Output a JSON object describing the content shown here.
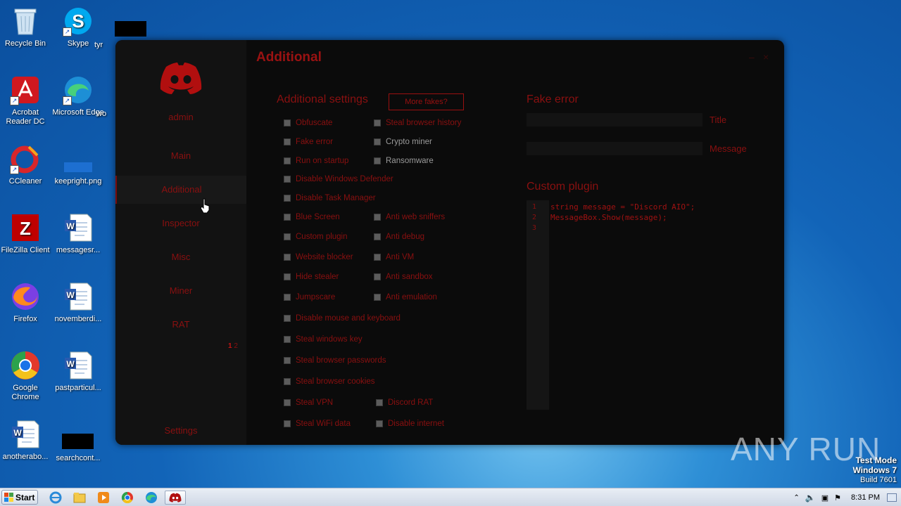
{
  "desktop": {
    "icons": [
      {
        "label": "Recycle Bin",
        "icon": "recycle-bin-icon"
      },
      {
        "label": "Skype",
        "icon": "skype-icon"
      },
      {
        "label": "tyr",
        "icon": "redacted"
      },
      {
        "label": "Acrobat Reader DC",
        "icon": "acrobat-icon"
      },
      {
        "label": "Microsoft Edge",
        "icon": "edge-icon"
      },
      {
        "label": "wo",
        "icon": "word-icon"
      },
      {
        "label": "CCleaner",
        "icon": "ccleaner-icon"
      },
      {
        "label": "keepright.png",
        "icon": "image-file-icon"
      },
      {
        "label": "FileZilla Client",
        "icon": "filezilla-icon"
      },
      {
        "label": "messagesr...",
        "icon": "word-doc-icon"
      },
      {
        "label": "Firefox",
        "icon": "firefox-icon"
      },
      {
        "label": "novemberdi...",
        "icon": "word-doc-icon"
      },
      {
        "label": "Google Chrome",
        "icon": "chrome-icon"
      },
      {
        "label": "pastparticul...",
        "icon": "word-doc-icon"
      },
      {
        "label": "anotherabo...",
        "icon": "word-doc-icon"
      },
      {
        "label": "searchcont...",
        "icon": "redacted"
      }
    ]
  },
  "app": {
    "title": "Additional",
    "controls": {
      "minimize": "–",
      "close": "×"
    },
    "sidebar": {
      "user": "admin",
      "items": [
        "Main",
        "Additional",
        "Inspector",
        "Misc",
        "Miner",
        "RAT"
      ],
      "active": "Additional",
      "pager": {
        "current": "1",
        "next": "2"
      },
      "settings": "Settings"
    },
    "additional_settings": {
      "title": "Additional settings",
      "more_button": "More fakes?",
      "left_column": [
        "Obfuscate",
        "Fake error",
        "Run on startup",
        "Disable Windows Defender",
        "Disable Task Manager",
        "Blue Screen",
        "Custom plugin",
        "Website blocker",
        "Hide stealer",
        "Jumpscare",
        "Disable mouse and keyboard",
        "Steal windows key",
        "Steal browser passwords",
        "Steal browser cookies",
        "Steal VPN",
        "Steal WiFi data"
      ],
      "right_column_top": [
        "Steal browser history",
        "Crypto miner",
        "Ransomware"
      ],
      "right_column_mid": [
        "Anti web sniffers",
        "Anti debug",
        "Anti VM",
        "Anti sandbox",
        "Anti emulation"
      ],
      "right_column_bottom": [
        "Discord RAT",
        "Disable internet"
      ]
    },
    "fake_error": {
      "title": "Fake error",
      "title_label": "Title",
      "message_label": "Message"
    },
    "custom_plugin": {
      "title": "Custom plugin",
      "line_numbers": [
        "1",
        "2",
        "3"
      ],
      "lines": [
        "string message = \"Discord AIO\";",
        "MessageBox.Show(message);",
        ""
      ]
    }
  },
  "watermark": {
    "brand": "ANY RUN",
    "test_mode": "Test Mode",
    "os": "Windows 7",
    "build": "Build 7601"
  },
  "taskbar": {
    "start": "Start",
    "clock": "8:31 PM"
  },
  "colors": {
    "accent": "#8a1010",
    "window_bg": "#0b0b0b",
    "sidebar_bg": "#121212"
  }
}
